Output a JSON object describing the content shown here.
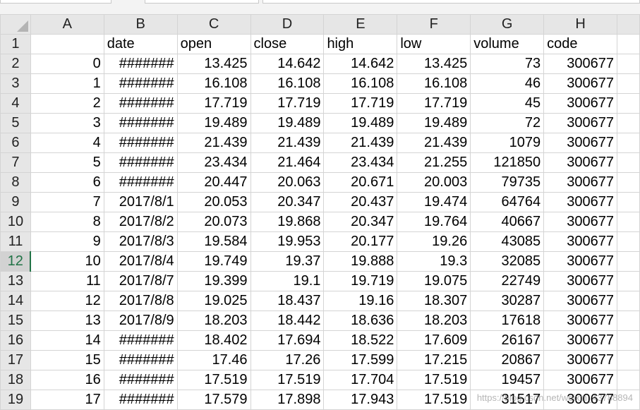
{
  "columns": [
    "A",
    "B",
    "C",
    "D",
    "E",
    "F",
    "G",
    "H"
  ],
  "header_row": {
    "row_number": "1",
    "cells": [
      "",
      "date",
      "open",
      "close",
      "high",
      "low",
      "volume",
      "code"
    ]
  },
  "active_row": "12",
  "rows": [
    {
      "n": "2",
      "cells": [
        "0",
        "#######",
        "13.425",
        "14.642",
        "14.642",
        "13.425",
        "73",
        "300677"
      ]
    },
    {
      "n": "3",
      "cells": [
        "1",
        "#######",
        "16.108",
        "16.108",
        "16.108",
        "16.108",
        "46",
        "300677"
      ]
    },
    {
      "n": "4",
      "cells": [
        "2",
        "#######",
        "17.719",
        "17.719",
        "17.719",
        "17.719",
        "45",
        "300677"
      ]
    },
    {
      "n": "5",
      "cells": [
        "3",
        "#######",
        "19.489",
        "19.489",
        "19.489",
        "19.489",
        "72",
        "300677"
      ]
    },
    {
      "n": "6",
      "cells": [
        "4",
        "#######",
        "21.439",
        "21.439",
        "21.439",
        "21.439",
        "1079",
        "300677"
      ]
    },
    {
      "n": "7",
      "cells": [
        "5",
        "#######",
        "23.434",
        "21.464",
        "23.434",
        "21.255",
        "121850",
        "300677"
      ]
    },
    {
      "n": "8",
      "cells": [
        "6",
        "#######",
        "20.447",
        "20.063",
        "20.671",
        "20.003",
        "79735",
        "300677"
      ]
    },
    {
      "n": "9",
      "cells": [
        "7",
        "2017/8/1",
        "20.053",
        "20.347",
        "20.437",
        "19.474",
        "64764",
        "300677"
      ]
    },
    {
      "n": "10",
      "cells": [
        "8",
        "2017/8/2",
        "20.073",
        "19.868",
        "20.347",
        "19.764",
        "40667",
        "300677"
      ]
    },
    {
      "n": "11",
      "cells": [
        "9",
        "2017/8/3",
        "19.584",
        "19.953",
        "20.177",
        "19.26",
        "43085",
        "300677"
      ]
    },
    {
      "n": "12",
      "cells": [
        "10",
        "2017/8/4",
        "19.749",
        "19.37",
        "19.888",
        "19.3",
        "32085",
        "300677"
      ]
    },
    {
      "n": "13",
      "cells": [
        "11",
        "2017/8/7",
        "19.399",
        "19.1",
        "19.719",
        "19.075",
        "22749",
        "300677"
      ]
    },
    {
      "n": "14",
      "cells": [
        "12",
        "2017/8/8",
        "19.025",
        "18.437",
        "19.16",
        "18.307",
        "30287",
        "300677"
      ]
    },
    {
      "n": "15",
      "cells": [
        "13",
        "2017/8/9",
        "18.203",
        "18.442",
        "18.636",
        "18.203",
        "17618",
        "300677"
      ]
    },
    {
      "n": "16",
      "cells": [
        "14",
        "#######",
        "18.402",
        "17.694",
        "18.522",
        "17.609",
        "26167",
        "300677"
      ]
    },
    {
      "n": "17",
      "cells": [
        "15",
        "#######",
        "17.46",
        "17.26",
        "17.599",
        "17.215",
        "20867",
        "300677"
      ]
    },
    {
      "n": "18",
      "cells": [
        "16",
        "#######",
        "17.519",
        "17.519",
        "17.704",
        "17.519",
        "19457",
        "300677"
      ]
    },
    {
      "n": "19",
      "cells": [
        "17",
        "#######",
        "17.579",
        "17.898",
        "17.943",
        "17.519",
        "31517",
        "300677"
      ]
    }
  ],
  "watermark": "https://blog.csdn.net/weixin_43788894"
}
